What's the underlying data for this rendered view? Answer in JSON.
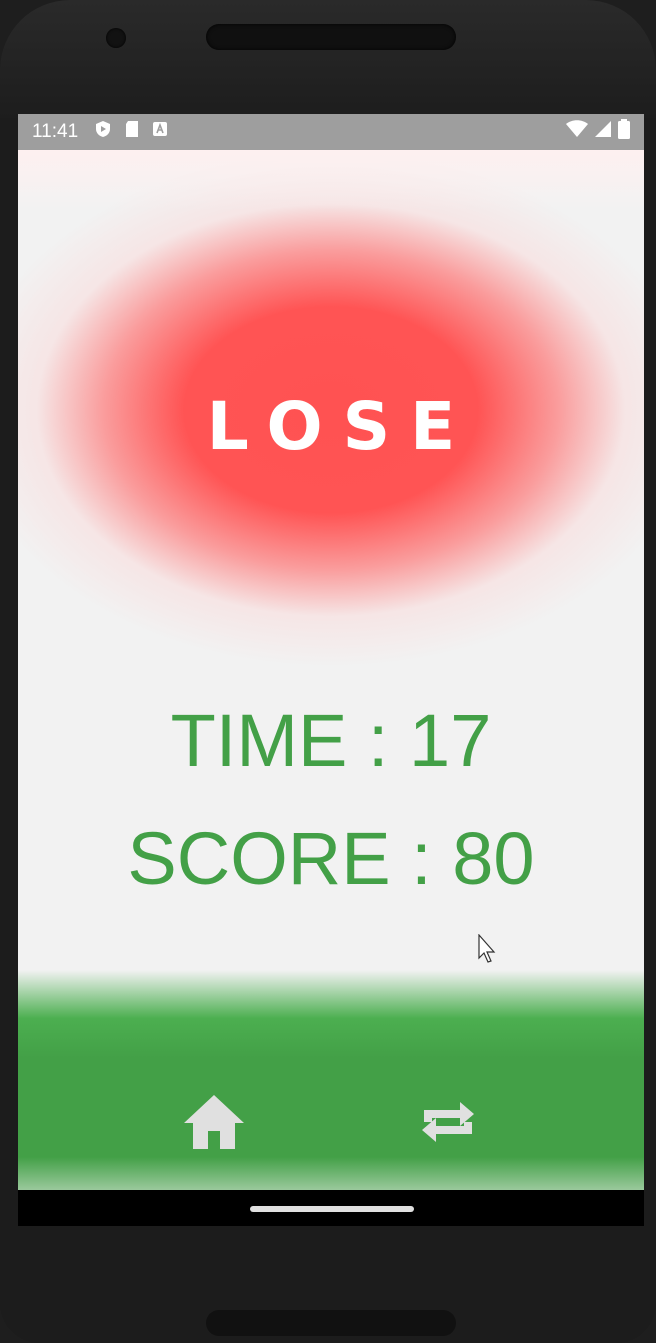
{
  "status_bar": {
    "time": "11:41"
  },
  "result": {
    "title": "LOSE"
  },
  "stats": {
    "time_text": "TIME : 17",
    "score_text": "SCORE : 80"
  },
  "actions": {
    "home_icon": "home-icon",
    "replay_icon": "repeat-icon"
  },
  "colors": {
    "lose_red": "#ff5252",
    "stat_green": "#43a047",
    "bar_green": "#43a047",
    "status_gray": "#9e9e9e"
  }
}
